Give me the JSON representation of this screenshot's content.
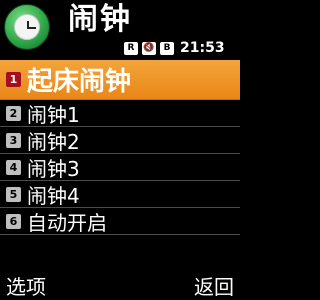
{
  "header": {
    "title": "闹钟",
    "icon": "alarm-clock-icon",
    "status": {
      "icons": [
        "R",
        "🔇",
        "B"
      ],
      "time": "21:53"
    }
  },
  "menu": {
    "items": [
      {
        "number": "1",
        "label": "起床闹钟",
        "selected": true
      },
      {
        "number": "2",
        "label": "闹钟1",
        "selected": false
      },
      {
        "number": "3",
        "label": "闹钟2",
        "selected": false
      },
      {
        "number": "4",
        "label": "闹钟3",
        "selected": false
      },
      {
        "number": "5",
        "label": "闹钟4",
        "selected": false
      },
      {
        "number": "6",
        "label": "自动开启",
        "selected": false
      }
    ]
  },
  "softkeys": {
    "left": "选项",
    "right": "返回"
  },
  "colors": {
    "selected_bg": "#eb8a1c",
    "selected_number_bg": "#a30f1e",
    "background": "#000000",
    "text": "#ffffff"
  }
}
